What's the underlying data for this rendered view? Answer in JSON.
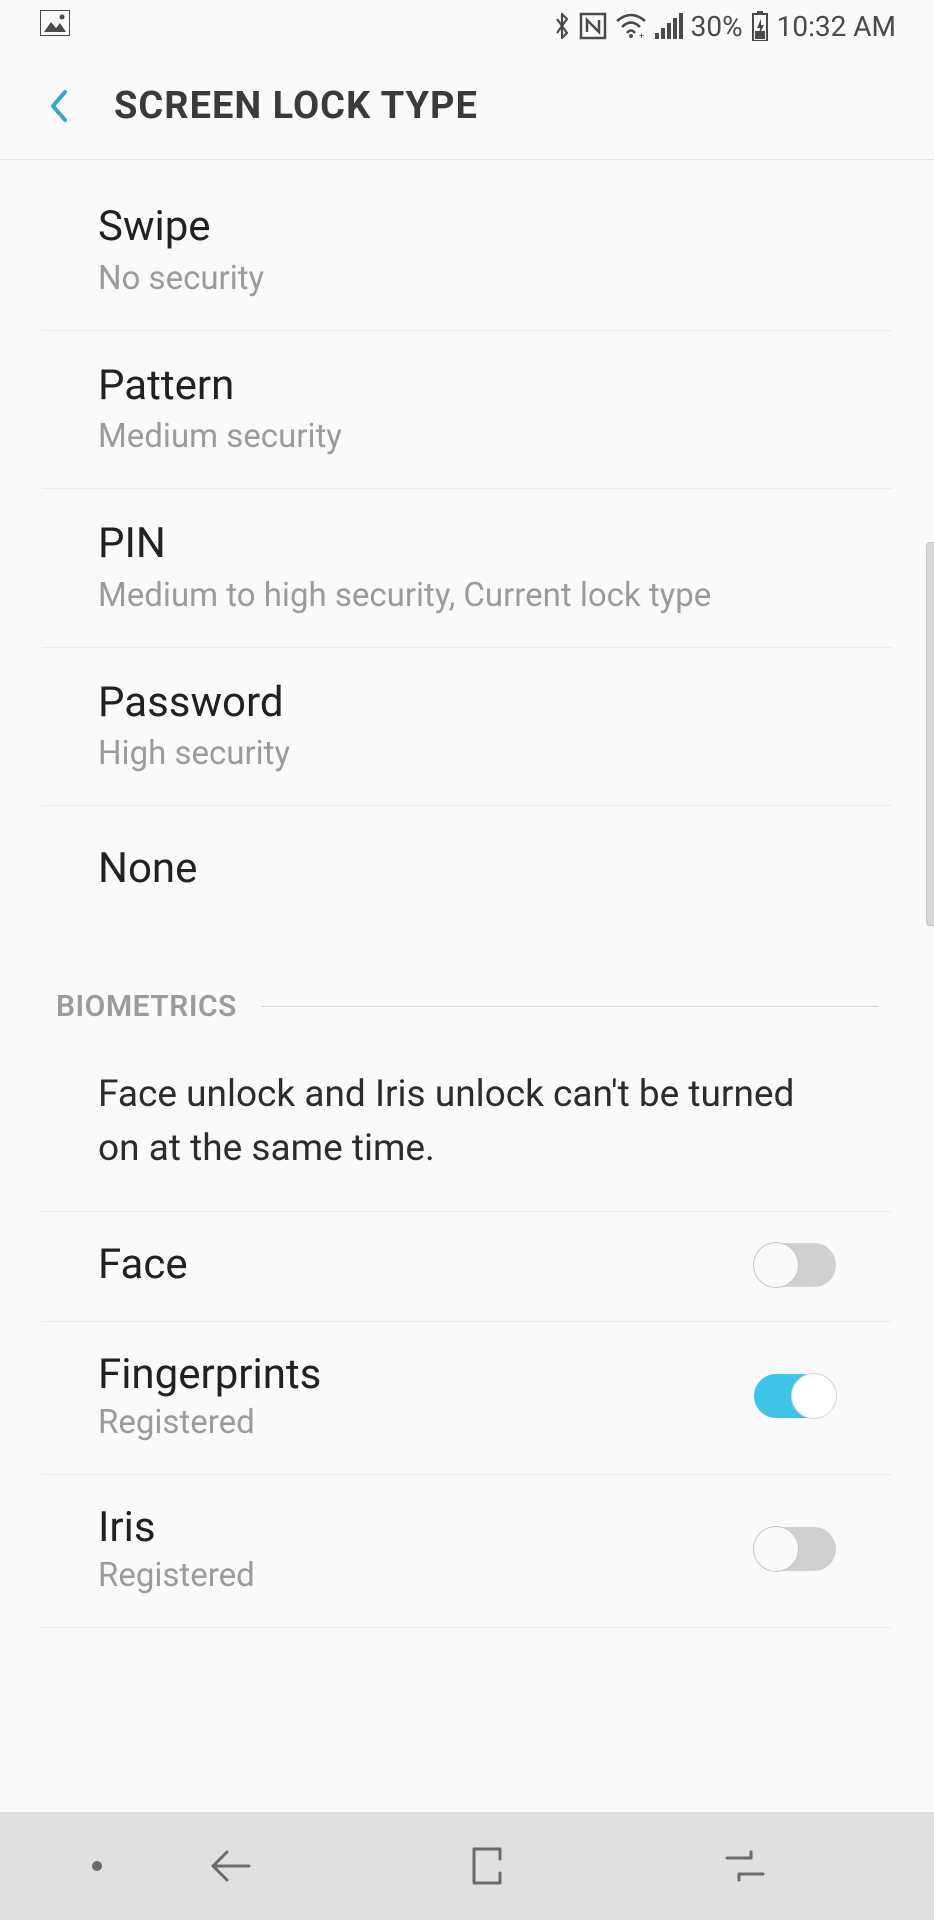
{
  "status_bar": {
    "battery_percent": "30%",
    "time": "10:32 AM"
  },
  "header": {
    "title": "SCREEN LOCK TYPE"
  },
  "lock_types": [
    {
      "title": "Swipe",
      "subtitle": "No security"
    },
    {
      "title": "Pattern",
      "subtitle": "Medium security"
    },
    {
      "title": "PIN",
      "subtitle": "Medium to high security, Current lock type"
    },
    {
      "title": "Password",
      "subtitle": "High security"
    },
    {
      "title": "None",
      "subtitle": ""
    }
  ],
  "biometrics": {
    "section_label": "BIOMETRICS",
    "note": "Face unlock and Iris unlock can't be turned on at the same time.",
    "items": [
      {
        "title": "Face",
        "subtitle": "",
        "enabled": false
      },
      {
        "title": "Fingerprints",
        "subtitle": "Registered",
        "enabled": true
      },
      {
        "title": "Iris",
        "subtitle": "Registered",
        "enabled": false
      }
    ]
  }
}
